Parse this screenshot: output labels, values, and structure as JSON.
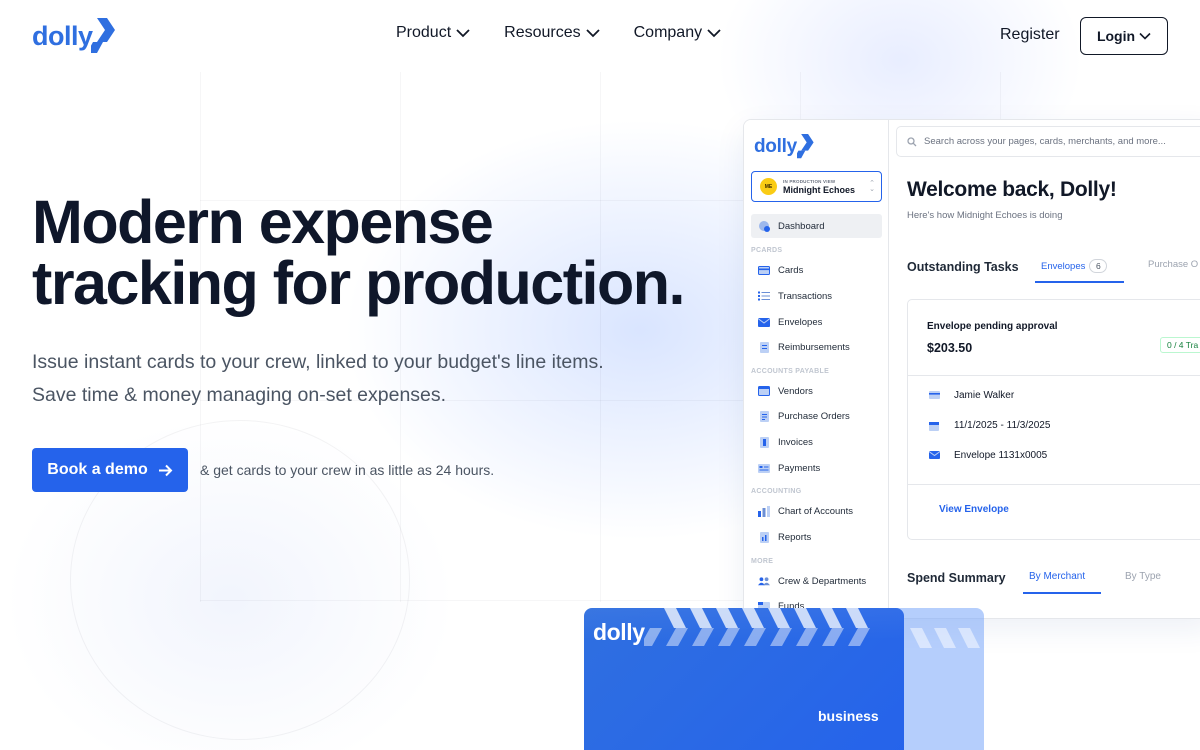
{
  "colors": {
    "brand": "#2f6fe0",
    "primary": "#2563eb",
    "text": "#0f172a",
    "muted": "#4b5563"
  },
  "header": {
    "logo": "dolly",
    "nav": [
      {
        "label": "Product",
        "icon": "chevron-down-icon"
      },
      {
        "label": "Resources",
        "icon": "chevron-down-icon"
      },
      {
        "label": "Company",
        "icon": "chevron-down-icon"
      }
    ],
    "register": "Register",
    "login": "Login"
  },
  "hero": {
    "title_line1": "Modern expense",
    "title_line2": "tracking for production.",
    "sub_line1": "Issue instant cards to your crew, linked to your budget's line items.",
    "sub_line2": "Save time & money managing on-set expenses.",
    "cta": "Book a demo",
    "cta_note": "& get cards to your crew in as little as 24 hours."
  },
  "app": {
    "logo": "dolly",
    "production": {
      "initials": "ME",
      "kicker": "IN PRODUCTION VIEW",
      "name": "Midnight Echoes"
    },
    "sidebar": {
      "dashboard": "Dashboard",
      "sections": [
        "PCARDS",
        "ACCOUNTS PAYABLE",
        "ACCOUNTING",
        "MORE"
      ],
      "items": [
        {
          "label": "Cards",
          "icon": "card-icon"
        },
        {
          "label": "Transactions",
          "icon": "list-icon"
        },
        {
          "label": "Envelopes",
          "icon": "envelope-icon"
        },
        {
          "label": "Reimbursements",
          "icon": "receipt-icon"
        },
        {
          "label": "Vendors",
          "icon": "vendor-icon"
        },
        {
          "label": "Purchase Orders",
          "icon": "document-icon"
        },
        {
          "label": "Invoices",
          "icon": "invoice-icon"
        },
        {
          "label": "Payments",
          "icon": "payment-icon"
        },
        {
          "label": "Chart of Accounts",
          "icon": "bar-chart-icon"
        },
        {
          "label": "Reports",
          "icon": "report-icon"
        },
        {
          "label": "Crew & Departments",
          "icon": "crew-icon"
        },
        {
          "label": "Funds",
          "icon": "funds-icon"
        }
      ]
    },
    "search_placeholder": "Search across your pages, cards, merchants, and more...",
    "welcome": "Welcome back, Dolly!",
    "welcome_sub": "Here's how Midnight Echoes is doing",
    "tasks": {
      "title": "Outstanding Tasks",
      "tabs": [
        {
          "label": "Envelopes",
          "count": "6"
        },
        {
          "label": "Purchase O"
        }
      ],
      "card": {
        "title": "Envelope pending approval",
        "amount": "$203.50",
        "badge": "0 / 4 Tra",
        "rows": [
          "Jamie Walker",
          "11/1/2025 - 11/3/2025",
          "Envelope 1131x0005"
        ],
        "link": "View Envelope"
      }
    },
    "spend": {
      "title": "Spend Summary",
      "tabs": [
        "By Merchant",
        "By Type"
      ]
    }
  },
  "card": {
    "logo": "dolly",
    "label": "business"
  }
}
